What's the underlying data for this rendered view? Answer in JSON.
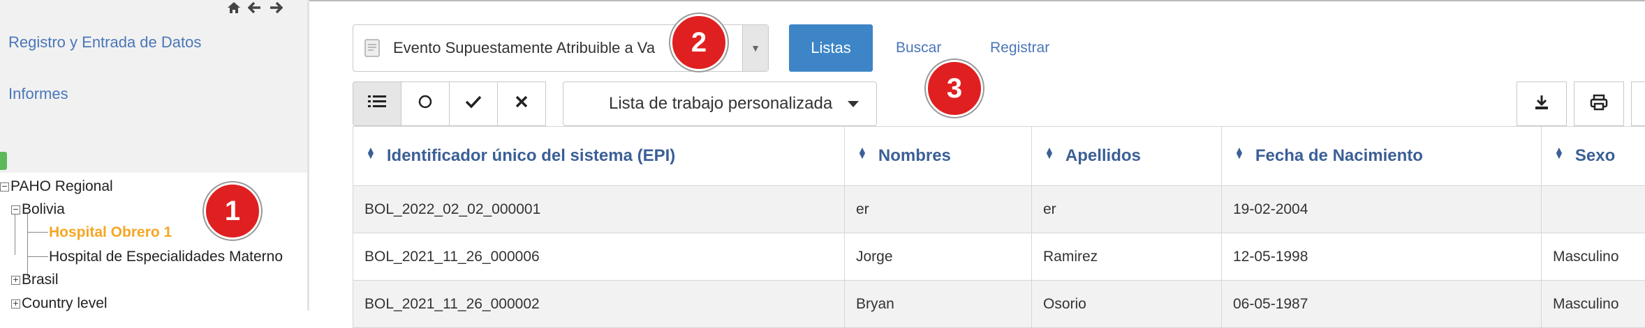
{
  "sidebar": {
    "links": [
      {
        "label": "Registro y Entrada de Datos"
      },
      {
        "label": "Informes"
      }
    ],
    "tree": {
      "root": "PAHO Regional",
      "bolivia": "Bolivia",
      "hospital1": "Hospital Obrero 1",
      "hospital2": "Hospital de Especialidades Materno",
      "brasil": "Brasil",
      "country": "Country level"
    }
  },
  "badges": [
    "1",
    "2",
    "3"
  ],
  "event_select": {
    "value": "Evento Supuestamente Atribuible a Va",
    "clear": "×",
    "arrow": "▼"
  },
  "nav": {
    "listas": "Listas",
    "buscar": "Buscar",
    "registrar": "Registrar"
  },
  "toolbar": {
    "worklist_label": "Lista de trabajo personalizada"
  },
  "table": {
    "headers": [
      "Identificador único del sistema (EPI)",
      "Nombres",
      "Apellidos",
      "Fecha de Nacimiento",
      "Sexo"
    ],
    "rows": [
      [
        "BOL_2022_02_02_000001",
        "er",
        "er",
        "19-02-2004",
        ""
      ],
      [
        "BOL_2021_11_26_000006",
        "Jorge",
        "Ramirez",
        "12-05-1998",
        "Masculino"
      ],
      [
        "BOL_2021_11_26_000002",
        "Bryan",
        "Osorio",
        "06-05-1987",
        "Masculino"
      ]
    ]
  },
  "colors": {
    "accent": "#3d85c6",
    "link": "#4a76b8",
    "badge": "#e02020",
    "active_node": "#f5a623",
    "header_text": "#3b5f96"
  },
  "icons": [
    "home-icon",
    "back-arrow-icon",
    "forward-arrow-icon",
    "document-icon",
    "list-icon",
    "circle-icon",
    "check-icon",
    "close-icon",
    "download-icon",
    "print-icon"
  ]
}
